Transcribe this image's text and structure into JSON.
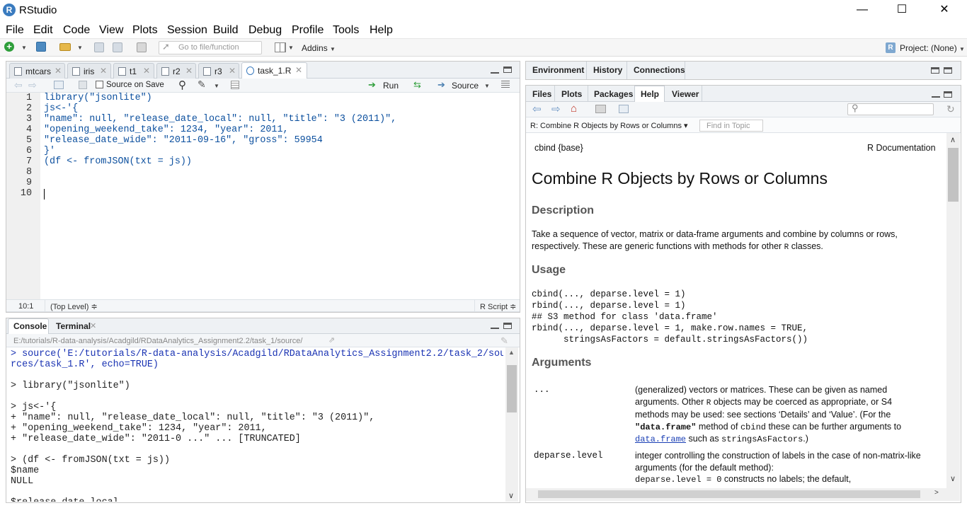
{
  "window": {
    "title": "RStudio",
    "logo": "R",
    "minimize": "—",
    "maximize": "☐",
    "close": "✕"
  },
  "menu": [
    "File",
    "Edit",
    "Code",
    "View",
    "Plots",
    "Session",
    "Build",
    "Debug",
    "Profile",
    "Tools",
    "Help"
  ],
  "toolbar": {
    "goto_placeholder": "Go to file/function",
    "addins": "Addins",
    "project": "Project: (None)"
  },
  "editor": {
    "tabs": [
      "mtcars",
      "iris",
      "t1",
      "r2",
      "r3",
      "task_1.R"
    ],
    "source_on_save": "Source on Save",
    "run": "Run",
    "source": "Source",
    "line_numbers": [
      "1",
      "2",
      "3",
      "4",
      "5",
      "6",
      "7",
      "8",
      "9",
      "10"
    ],
    "lines": [
      "library(\"jsonlite\")",
      "js<-'{",
      "\"name\": null, \"release_date_local\": null, \"title\": \"3 (2011)\",",
      "\"opening_weekend_take\": 1234, \"year\": 2011,",
      "\"release_date_wide\": \"2011-09-16\", \"gross\": 59954",
      "}'",
      "(df <- fromJSON(txt = js))",
      "",
      "",
      ""
    ],
    "status_pos": "10:1",
    "status_scope": "(Top Level) ≑",
    "status_type": "R Script ≑"
  },
  "console": {
    "tabs": [
      "Console",
      "Terminal"
    ],
    "path": "E:/tutorials/R-data-analysis/Acadgild/RDataAnalytics_Assignment2.2/task_1/source/",
    "lines": [
      {
        "t": "> source('E:/tutorials/R-data-analysis/Acadgild/RDataAnalytics_Assignment2.2/task_2/sou",
        "c": "blue"
      },
      {
        "t": "rces/task_1.R', echo=TRUE)",
        "c": "blue"
      },
      {
        "t": "",
        "c": "dk"
      },
      {
        "t": "> library(\"jsonlite\")",
        "c": "dk"
      },
      {
        "t": "",
        "c": "dk"
      },
      {
        "t": "> js<-'{",
        "c": "dk"
      },
      {
        "t": "+ \"name\": null, \"release_date_local\": null, \"title\": \"3 (2011)\",",
        "c": "dk"
      },
      {
        "t": "+ \"opening_weekend_take\": 1234, \"year\": 2011,",
        "c": "dk"
      },
      {
        "t": "+ \"release_date_wide\": \"2011-0 ...\" ... [TRUNCATED]",
        "c": "dk"
      },
      {
        "t": "",
        "c": "dk"
      },
      {
        "t": "> (df <- fromJSON(txt = js))",
        "c": "dk"
      },
      {
        "t": "$name",
        "c": "dk"
      },
      {
        "t": "NULL",
        "c": "dk"
      },
      {
        "t": "",
        "c": "dk"
      },
      {
        "t": "$release_date_local",
        "c": "dk"
      }
    ]
  },
  "env_tabs": [
    "Environment",
    "History",
    "Connections"
  ],
  "help_tabs": [
    "Files",
    "Plots",
    "Packages",
    "Help",
    "Viewer"
  ],
  "help": {
    "topic": "R: Combine R Objects by Rows or Columns ▾",
    "find_placeholder": "Find in Topic",
    "pkg": "cbind {base}",
    "rdoc": "R Documentation",
    "title": "Combine R Objects by Rows or Columns",
    "description_h": "Description",
    "description_1": "Take a sequence of vector, matrix or data-frame arguments and combine by columns or rows,",
    "description_2a": "respectively. These are generic functions with methods for other ",
    "description_2r": "R",
    "description_2b": " classes.",
    "usage_h": "Usage",
    "usage": [
      "cbind(..., deparse.level = 1)",
      "rbind(..., deparse.level = 1)",
      "## S3 method for class 'data.frame'",
      "rbind(..., deparse.level = 1, make.row.names = TRUE,",
      "      stringsAsFactors = default.stringsAsFactors())"
    ],
    "arguments_h": "Arguments",
    "arg1_name": "...",
    "arg1_l1": "(generalized) vectors or matrices. These can be given as named",
    "arg1_l2a": "arguments. Other ",
    "arg1_l2r": "R",
    "arg1_l2b": " objects may be coerced as appropriate, or S4",
    "arg1_l3": "methods may be used: see sections ‘Details’ and ‘Value’. (For the",
    "arg1_l4a": "\"data.frame\"",
    "arg1_l4b": " method of ",
    "arg1_l4c": "cbind",
    "arg1_l4d": " these can be further arguments to",
    "arg1_l5a": "data.frame",
    "arg1_l5b": " such as ",
    "arg1_l5c": "stringsAsFactors",
    "arg1_l5d": ".)",
    "arg2_name": "deparse.level",
    "arg2_l1": "integer controlling the construction of labels in the case of non-matrix-like",
    "arg2_l2": "arguments (for the default method):",
    "arg2_l3a": "deparse.level = 0",
    "arg2_l3b": " constructs no labels; the default,"
  },
  "colors": {
    "link": "#1a3fb5",
    "editor_code": "#0b4f9e",
    "console_cmd": "#1a33b3",
    "green": "#2e9e3a"
  }
}
